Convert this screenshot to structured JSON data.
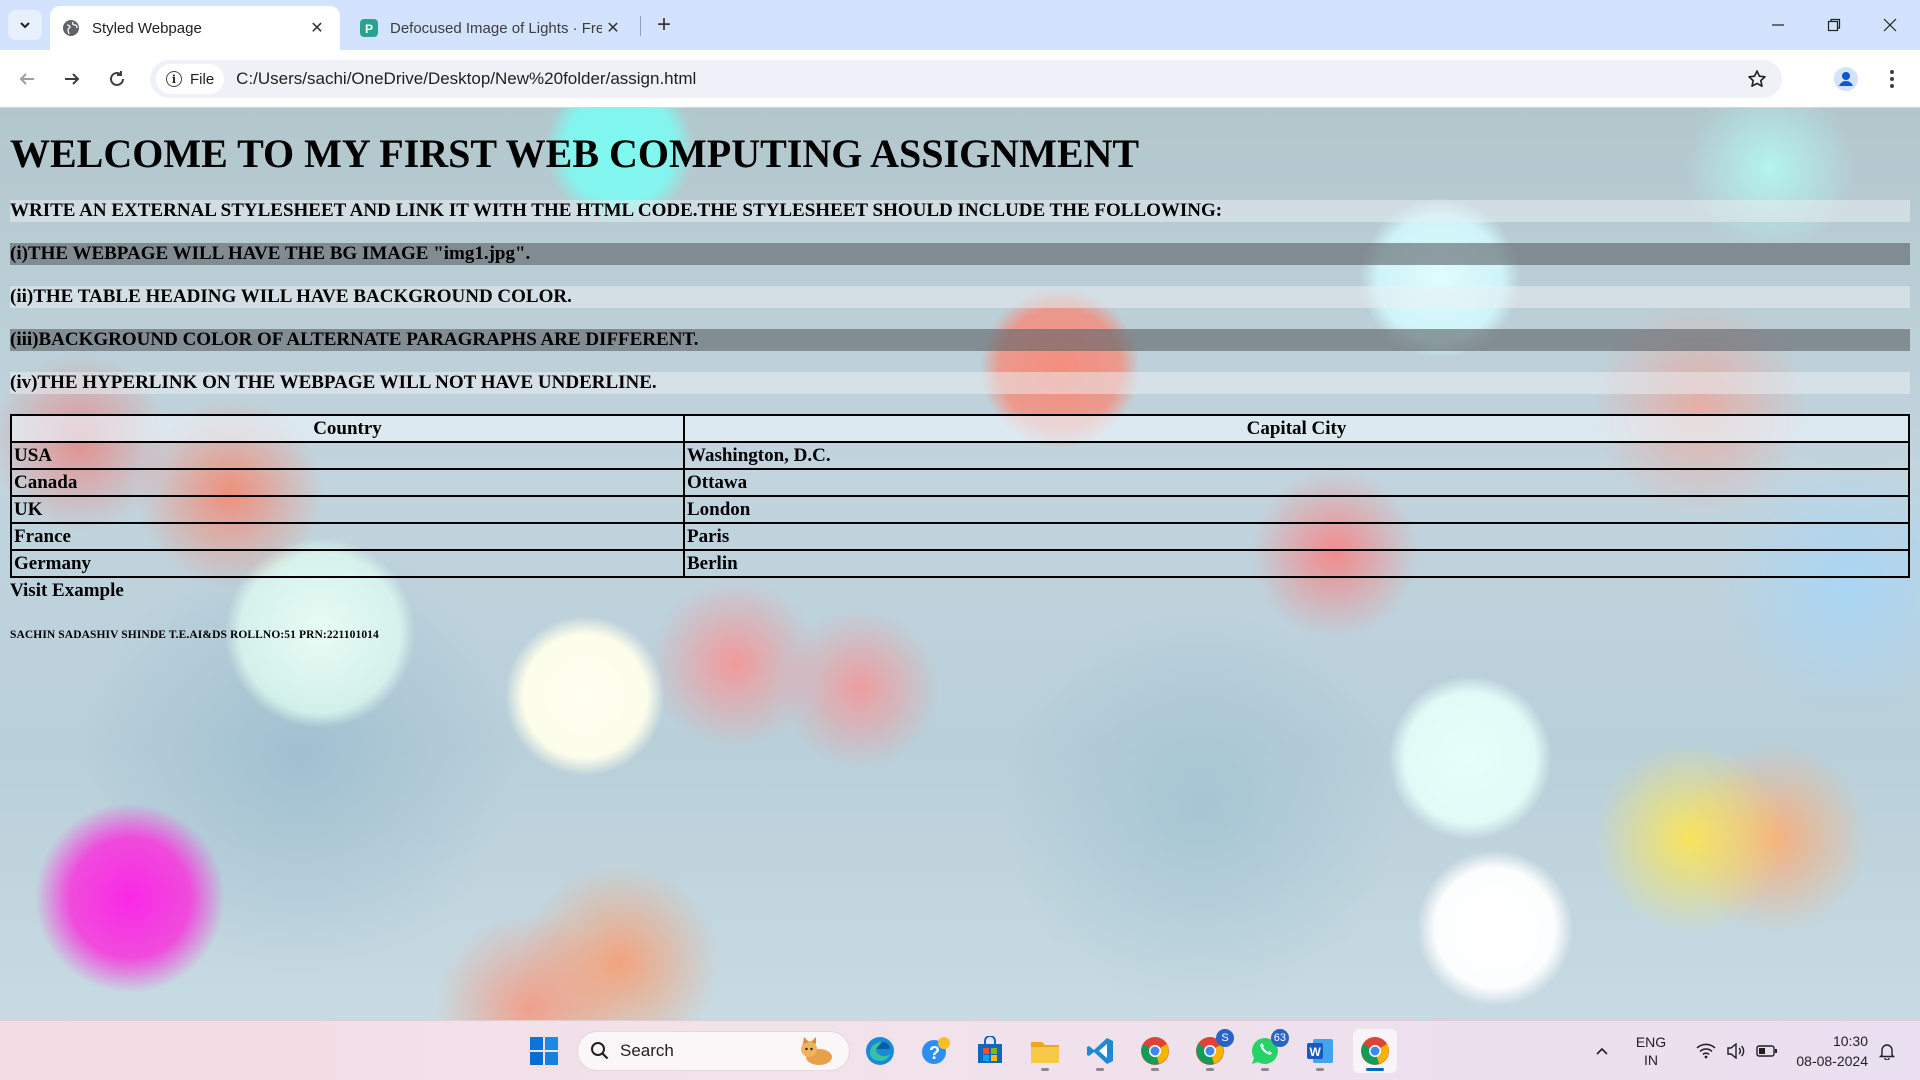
{
  "browser": {
    "tabs": [
      {
        "title": "Styled Webpage",
        "active": true
      },
      {
        "title": "Defocused Image of Lights · Fre",
        "active": false
      }
    ],
    "address": {
      "chip_label": "File",
      "url": "C:/Users/sachi/OneDrive/Desktop/New%20folder/assign.html"
    }
  },
  "page": {
    "heading": "WELCOME TO MY FIRST WEB COMPUTING ASSIGNMENT",
    "paragraphs": [
      "WRITE AN EXTERNAL STYLESHEET AND LINK IT WITH THE HTML CODE.THE STYLESHEET SHOULD INCLUDE THE FOLLOWING:",
      "(i)THE WEBPAGE WILL HAVE THE BG IMAGE \"img1.jpg\".",
      "(ii)THE TABLE HEADING WILL HAVE BACKGROUND COLOR.",
      "(iii)BACKGROUND COLOR OF ALTERNATE PARAGRAPHS ARE DIFFERENT.",
      "(iv)THE HYPERLINK ON THE WEBPAGE WILL NOT HAVE UNDERLINE."
    ],
    "table": {
      "headers": [
        "Country",
        "Capital City"
      ],
      "rows": [
        [
          "USA",
          "Washington, D.C."
        ],
        [
          "Canada",
          "Ottawa"
        ],
        [
          "UK",
          "London"
        ],
        [
          "France",
          "Paris"
        ],
        [
          "Germany",
          "Berlin"
        ]
      ]
    },
    "link_text": "Visit Example",
    "footer": "SACHIN SADASHIV SHINDE T.E.AI&DS ROLLNO:51 PRN:221101014"
  },
  "taskbar": {
    "search_label": "Search",
    "badges": {
      "chrome_profile": "S",
      "whatsapp": "63"
    },
    "language": {
      "line1": "ENG",
      "line2": "IN"
    },
    "time": "10:30",
    "date": "08-08-2024"
  },
  "colors": {
    "tab_strip": "#d3e3fd",
    "accent": "#0067c0",
    "paragraph_dark": "#5f6469",
    "paragraph_light": "#ebf0f3"
  }
}
